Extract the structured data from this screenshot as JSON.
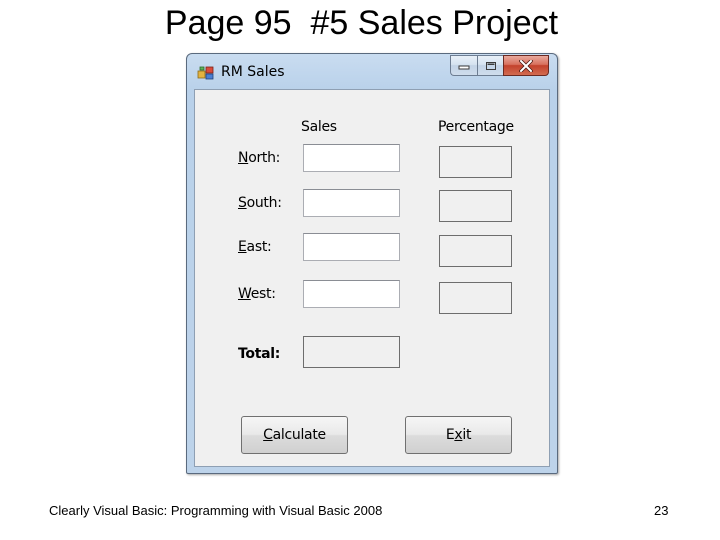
{
  "slide": {
    "title": "Page 95  #5 Sales Project",
    "footer_left": "Clearly Visual Basic: Programming with Visual Basic 2008",
    "page_number": "23"
  },
  "window": {
    "title": "RM Sales",
    "icon": "application-icon",
    "controls": {
      "minimize_icon": "minimize-icon",
      "maximize_icon": "maximize-icon",
      "close_icon": "close-icon"
    }
  },
  "form": {
    "headers": {
      "sales": "Sales",
      "percentage": "Percentage"
    },
    "rows": [
      {
        "label_first": "N",
        "label_rest": "orth:",
        "sales_value": "",
        "percentage_value": ""
      },
      {
        "label_first": "S",
        "label_rest": "outh:",
        "sales_value": "",
        "percentage_value": ""
      },
      {
        "label_first": "E",
        "label_rest": "ast:",
        "sales_value": "",
        "percentage_value": ""
      },
      {
        "label_first": "W",
        "label_rest": "est:",
        "sales_value": "",
        "percentage_value": ""
      }
    ],
    "total_label": "Total:",
    "total_value": "",
    "buttons": {
      "calculate_first": "C",
      "calculate_rest": "alculate",
      "exit_pre": "E",
      "exit_underline": "x",
      "exit_post": "it"
    }
  }
}
